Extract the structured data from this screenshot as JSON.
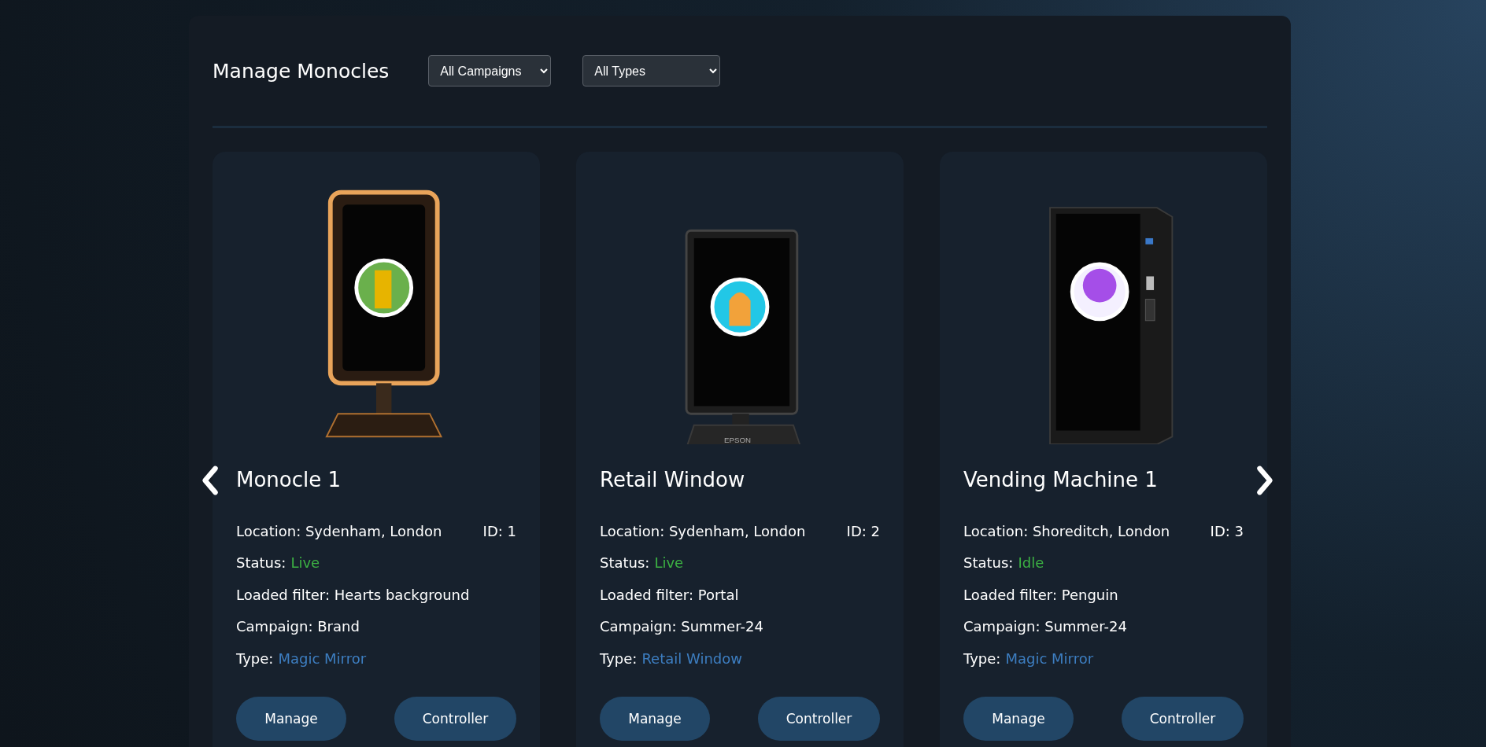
{
  "page_title": "Manage Monocles",
  "filters": [
    {
      "value": "All Campaigns"
    },
    {
      "value": "All Types"
    }
  ],
  "cards": [
    {
      "kind": "mirror",
      "name": "Monocle 1",
      "location_label": "Location:",
      "location": "Sydenham, London",
      "id": "ID: 1",
      "status_label": "Status:",
      "status": "Live",
      "filter_label": "Loaded filter:",
      "filter": "Hearts background",
      "campaign_label": "Campaign:",
      "campaign": "Brand",
      "type_label": "Type:",
      "type": "Magic Mirror",
      "buttons": [
        "Manage",
        "Controller"
      ]
    },
    {
      "kind": "tablet",
      "name": "Retail Window",
      "location_label": "Location:",
      "location": "Sydenham, London",
      "id": "ID: 2",
      "status_label": "Status:",
      "status": "Live",
      "filter_label": "Loaded filter:",
      "filter": "Portal",
      "campaign_label": "Campaign:",
      "campaign": "Summer-24",
      "type_label": "Type:",
      "type": "Retail Window",
      "buttons": [
        "Manage",
        "Controller"
      ],
      "brand": "EPSON"
    },
    {
      "kind": "vending",
      "name": "Vending Machine 1",
      "location_label": "Location:",
      "location": "Shoreditch, London",
      "id": "ID: 3",
      "status_label": "Status:",
      "status": "Idle",
      "filter_label": "Loaded filter:",
      "filter": "Penguin",
      "campaign_label": "Campaign:",
      "campaign": "Summer-24",
      "type_label": "Type:",
      "type": "Magic Mirror",
      "buttons": [
        "Manage",
        "Controller"
      ]
    }
  ]
}
